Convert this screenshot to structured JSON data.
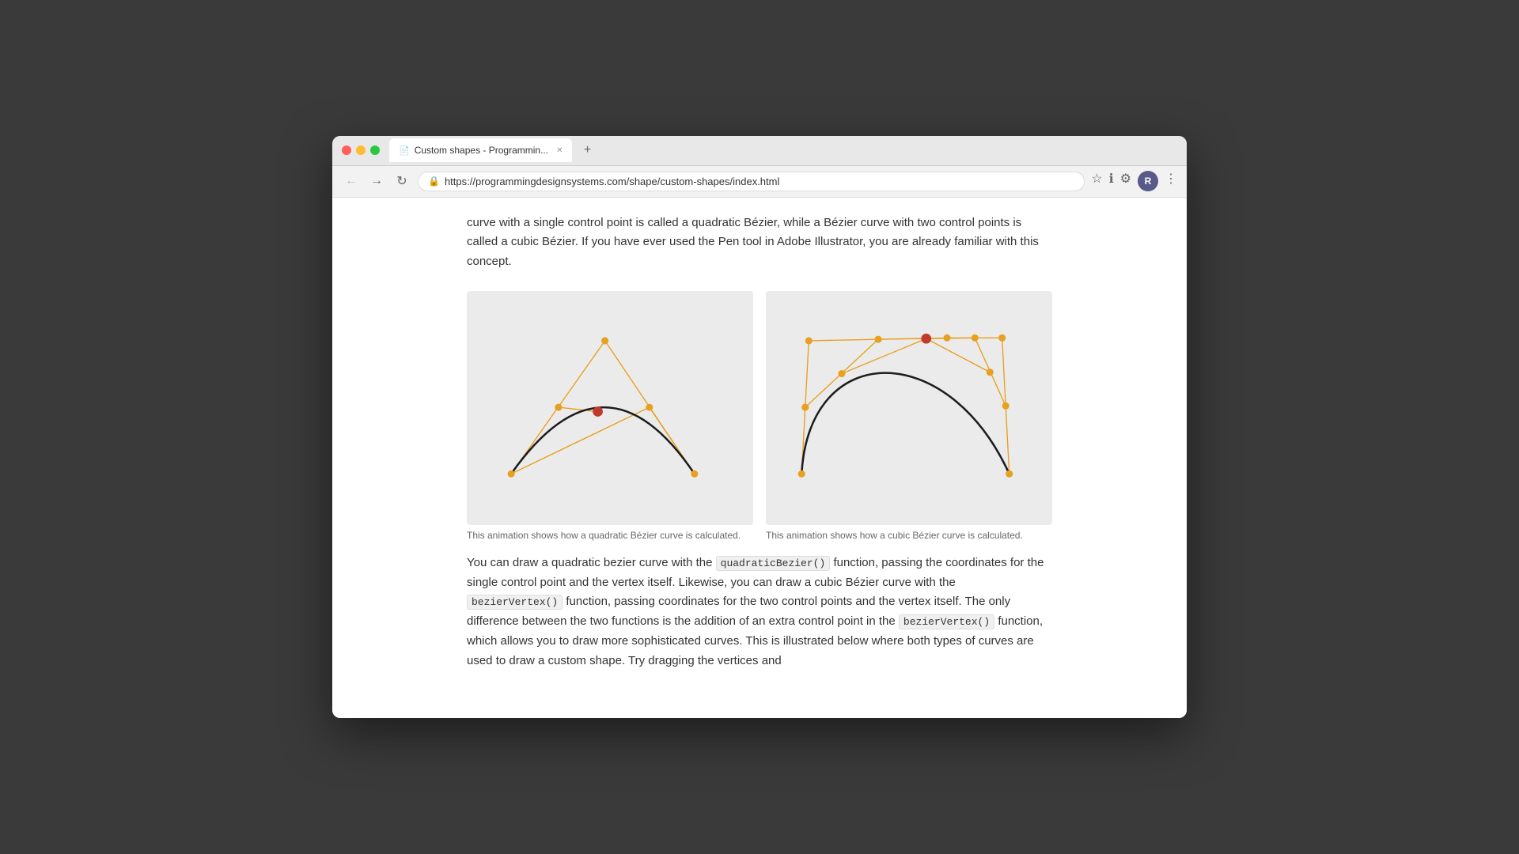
{
  "browser": {
    "tab_title": "Custom shapes - Programmin...",
    "tab_url": "https://programmingdesignsystems.com/shape/custom-shapes/index.html",
    "profile_letter": "R"
  },
  "page": {
    "intro_text": "curve with a single control point is called a quadratic Bézier, while a Bézier curve with two control points is called a cubic Bézier. If you have ever used the Pen tool in Adobe Illustrator, you are already familiar with this concept.",
    "diagram_left_caption": "This animation shows how a quadratic Bézier curve is calculated.",
    "diagram_right_caption": "This animation shows how a cubic Bézier curve is calculated.",
    "body_paragraph": "You can draw a quadratic bezier curve with the",
    "code1": "quadraticBezier()",
    "body_part2": "function, passing the coordinates for the single control point and the vertex itself. Likewise, you can draw a cubic Bézier curve with the",
    "code2": "bezierVertex()",
    "body_part3": "function, passing coordinates for the two control points and the vertex itself. The only difference between the two functions is the addition of an extra control point in the",
    "code3": "bezierVertex()",
    "body_part4": "function, which allows you to draw more sophisticated curves. This is illustrated below where both types of curves are used to draw a custom shape. Try dragging the vertices and"
  }
}
